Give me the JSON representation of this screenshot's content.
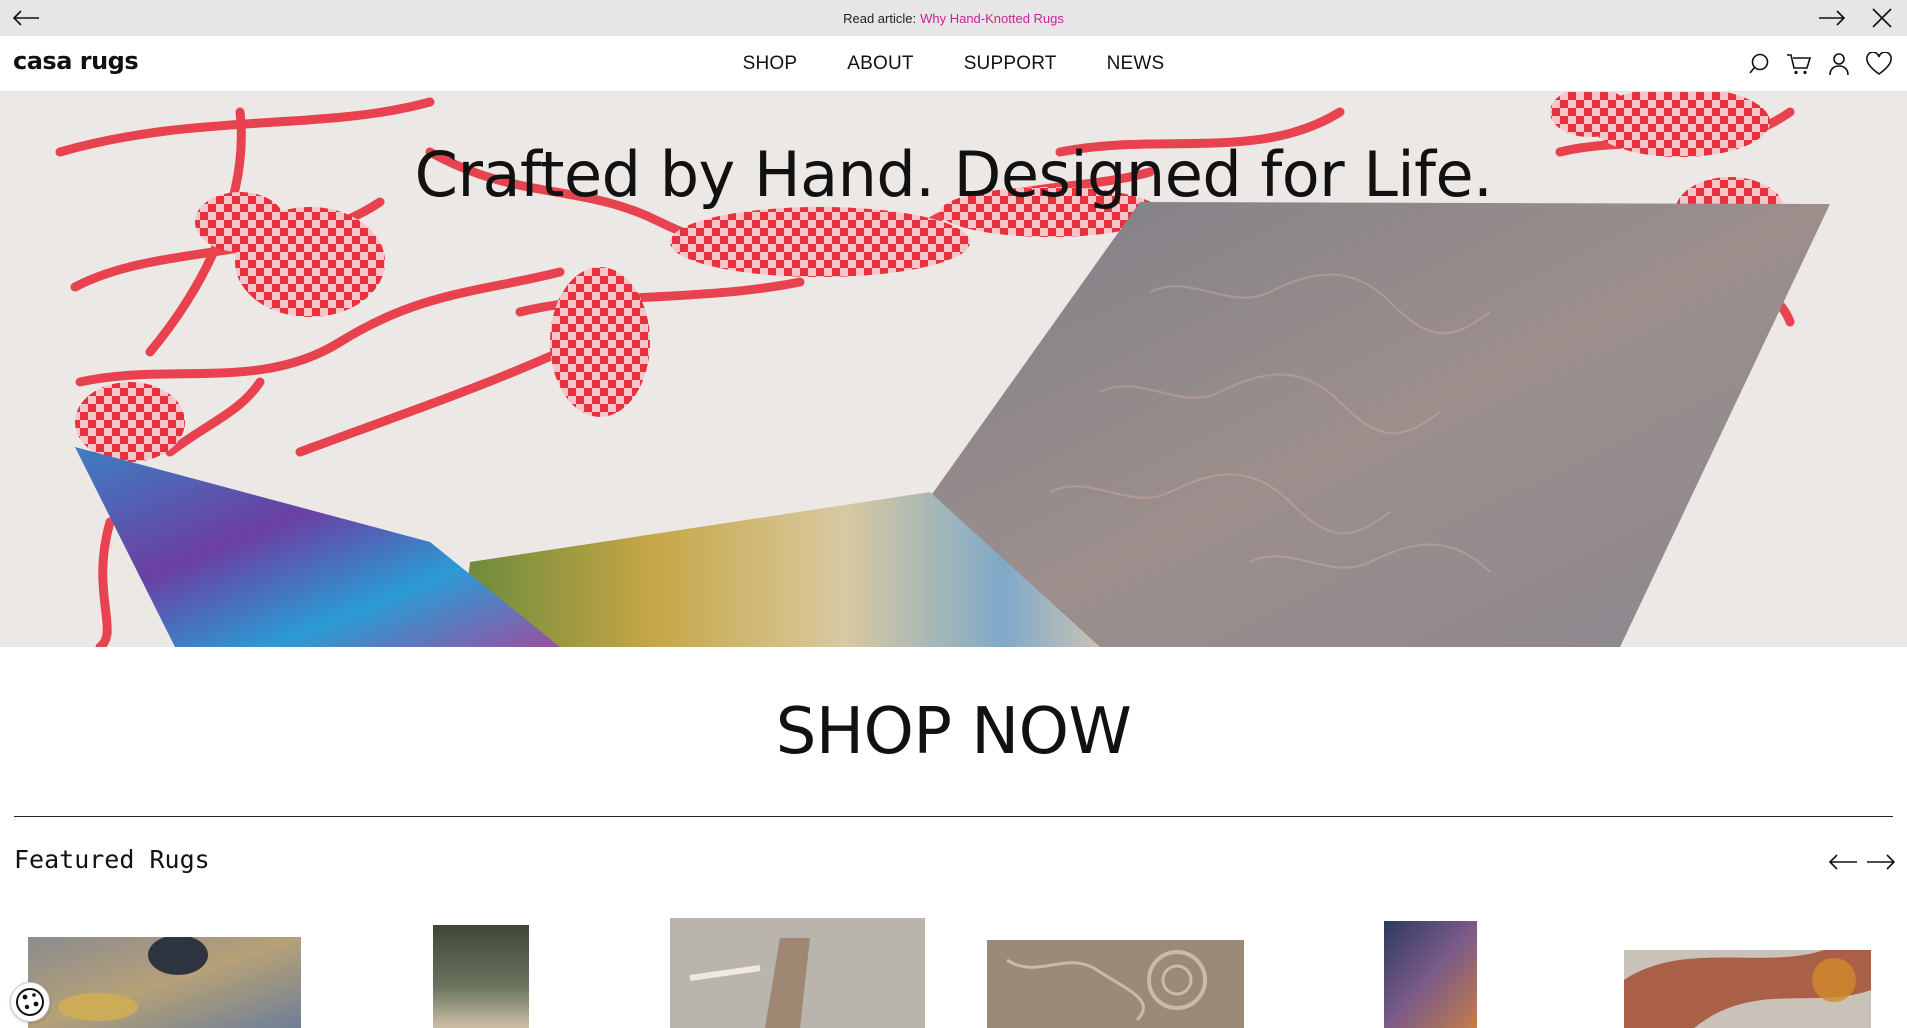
{
  "announcement": {
    "prefix": "Read article:",
    "link_text": "Why Hand-Knotted Rugs",
    "link_color": "#d01e9a"
  },
  "header": {
    "logo": "casa rugs",
    "nav": [
      "SHOP",
      "ABOUT",
      "SUPPORT",
      "NEWS"
    ],
    "icons": [
      "search-icon",
      "cart-icon",
      "account-icon",
      "wishlist-icon"
    ]
  },
  "hero": {
    "headline": "Crafted by Hand. Designed for Life.",
    "pattern_color": "#e8313f"
  },
  "cta": {
    "label": "SHOP NOW"
  },
  "featured": {
    "title": "Featured Rugs",
    "products": [
      "rug-1",
      "rug-2",
      "rug-3",
      "rug-4",
      "rug-5",
      "rug-6"
    ]
  },
  "colors": {
    "announcement_bg": "#e6e6e6",
    "link": "#d01e9a",
    "text": "#111111"
  }
}
